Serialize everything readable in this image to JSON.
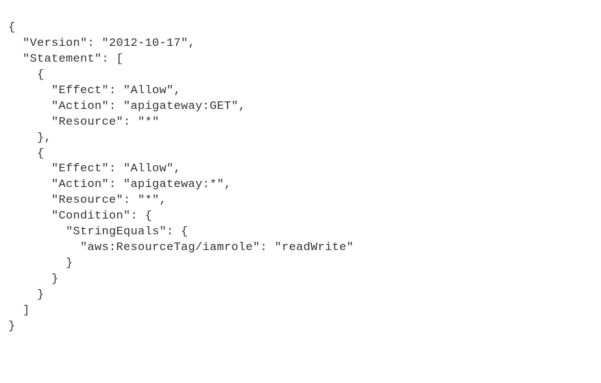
{
  "code_lines": [
    "{",
    "  \"Version\": \"2012-10-17\",",
    "  \"Statement\": [",
    "    {",
    "      \"Effect\": \"Allow\",",
    "      \"Action\": \"apigateway:GET\",",
    "      \"Resource\": \"*\"",
    "    },",
    "    {",
    "      \"Effect\": \"Allow\",",
    "      \"Action\": \"apigateway:*\",",
    "      \"Resource\": \"*\",",
    "      \"Condition\": {",
    "        \"StringEquals\": {",
    "          \"aws:ResourceTag/iamrole\": \"readWrite\"",
    "        }",
    "      }",
    "    }",
    "  ]",
    "}"
  ],
  "policy_json": {
    "Version": "2012-10-17",
    "Statement": [
      {
        "Effect": "Allow",
        "Action": "apigateway:GET",
        "Resource": "*"
      },
      {
        "Effect": "Allow",
        "Action": "apigateway:*",
        "Resource": "*",
        "Condition": {
          "StringEquals": {
            "aws:ResourceTag/iamrole": "readWrite"
          }
        }
      }
    ]
  }
}
